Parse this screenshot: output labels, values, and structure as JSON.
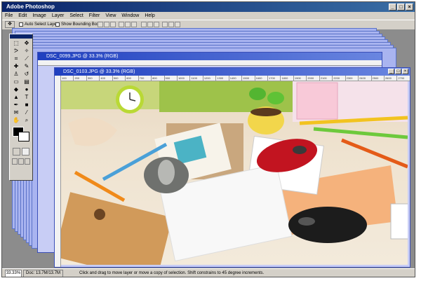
{
  "app": {
    "title": "Adobe Photoshop"
  },
  "window_controls": {
    "minimize": "_",
    "maximize": "□",
    "close": "×"
  },
  "menu": [
    "File",
    "Edit",
    "Image",
    "Layer",
    "Select",
    "Filter",
    "View",
    "Window",
    "Help"
  ],
  "options_bar": {
    "tool_icon": "move-tool-icon",
    "auto_select_layer": "Auto Select Layer",
    "show_bounding_box": "Show Bounding Box"
  },
  "documents": [
    {
      "title": "DSC_0099.JPG @ 33.3% (RGB)"
    },
    {
      "title": "DSC_0103.JPG @ 33.3% (RGB)"
    }
  ],
  "ruler_ticks": [
    "100",
    "200",
    "300",
    "400",
    "500",
    "600",
    "700",
    "800",
    "900",
    "1000",
    "1100",
    "1200",
    "1300",
    "1400",
    "1500",
    "1600",
    "1700",
    "1800",
    "1900",
    "2000",
    "2100",
    "2200",
    "2300",
    "2400",
    "2500",
    "2600",
    "2700"
  ],
  "statusbar": {
    "zoom": "33.33%",
    "doc": "Doc: 13.7M/13.7M",
    "hint": "Click and drag to move layer or move a copy of selection. Shift constrains to 45 degree increments."
  },
  "colors": {
    "title_active": "#0a246a",
    "doc_title": "#1f3fbf",
    "workspace": "#8c8c8c",
    "chrome": "#d4d0c8"
  }
}
